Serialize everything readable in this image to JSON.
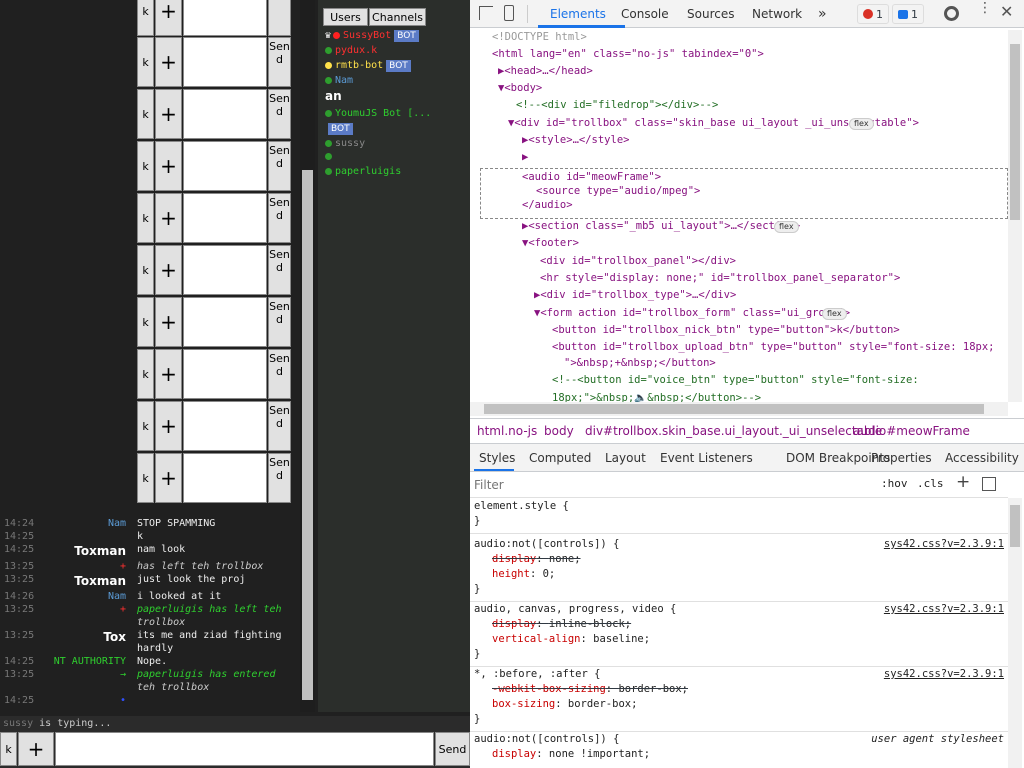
{
  "chat_form_rows": [
    {
      "k": "k",
      "plus": "+",
      "send": "end"
    },
    {
      "k": "k",
      "plus": "+",
      "send": "Send"
    },
    {
      "k": "k",
      "plus": "+",
      "send": "Send"
    },
    {
      "k": "k",
      "plus": "+",
      "send": "Send"
    },
    {
      "k": "k",
      "plus": "+",
      "send": "Send"
    },
    {
      "k": "k",
      "plus": "+",
      "send": "Send"
    },
    {
      "k": "k",
      "plus": "+",
      "send": "Send"
    },
    {
      "k": "k",
      "plus": "+",
      "send": "Send"
    },
    {
      "k": "k",
      "plus": "+",
      "send": "Send"
    },
    {
      "k": "k",
      "plus": "+",
      "send": "Send"
    }
  ],
  "users_panel": {
    "tabs": [
      "Users",
      "Channels"
    ],
    "users": [
      {
        "icon": "♛",
        "dot": "#ff2020",
        "name": "SussyBot",
        "color": "#ff3030",
        "bot": "BOT"
      },
      {
        "dot": "#2e9e2e",
        "name": "pydux.k",
        "color": "#ff3030",
        "bot": ""
      },
      {
        "dot": "#ffe14a",
        "name": "rmtb-bot",
        "color": "#ffe14a",
        "bot": "BOT"
      },
      {
        "dot": "#2e9e2e",
        "name": "Nam",
        "color": "#5b9bd5",
        "bot": ""
      },
      {
        "dot": "",
        "name": "an",
        "color": "#ffffff",
        "bot": ""
      },
      {
        "dot": "#2e9e2e",
        "name": "YoumuJS Bot [...",
        "color": "#2fcf2f",
        "bot": ""
      },
      {
        "dot": "",
        "name": "",
        "color": "#fff",
        "bot": "BOT"
      },
      {
        "dot": "#2e9e2e",
        "name": "sussy",
        "color": "#888888",
        "bot": ""
      },
      {
        "dot": "#2e9e2e",
        "name": "",
        "color": "#3050ff",
        "bot": ""
      },
      {
        "dot": "#2e9e2e",
        "name": "paperluigis",
        "color": "#2fcf2f",
        "bot": ""
      }
    ]
  },
  "messages": [
    {
      "time": "14:24",
      "nick": "Nam",
      "nick_color": "#5b9bd5",
      "text": "STOP SPAMMING",
      "italic": false
    },
    {
      "time": "14:25",
      "nick": "",
      "nick_color": "#888",
      "text": "k",
      "italic": false
    },
    {
      "time": "14:25",
      "nick": "Toxman",
      "nick_color": "#ffffff",
      "text": "nam look",
      "italic": false
    },
    {
      "time": "13:25",
      "nick": "+",
      "nick_color": "#ff3030",
      "text": "has left teh trollbox",
      "italic": true
    },
    {
      "time": "13:25",
      "nick": "Toxman",
      "nick_color": "#ffffff",
      "text": "just look the proj",
      "italic": false
    },
    {
      "time": "14:26",
      "nick": "Nam",
      "nick_color": "#5b9bd5",
      "text": "i looked at it",
      "italic": false
    },
    {
      "time": "13:25",
      "nick": "+",
      "nick_color": "#ff3030",
      "text": "paperluigis has left teh",
      "italic": true
    },
    {
      "time": "",
      "nick": "",
      "nick_color": "#888",
      "text": "trollbox",
      "italic": true
    },
    {
      "time": "13:25",
      "nick": "Tox",
      "nick_color": "#ffffff",
      "text": "its me and ziad fighting",
      "italic": false
    },
    {
      "time": "",
      "nick": "",
      "nick_color": "#888",
      "text": "hardly",
      "italic": false
    },
    {
      "time": "14:25",
      "nick": "NT AUTHORITY",
      "nick_color": "#2fcf2f",
      "text": "Nope.",
      "italic": false
    },
    {
      "time": "13:25",
      "nick": "→",
      "nick_color": "#2fcf2f",
      "text": "paperluigis has entered",
      "italic": true
    },
    {
      "time": "",
      "nick": "",
      "nick_color": "#888",
      "text": "teh trollbox",
      "italic": true
    },
    {
      "time": "14:25",
      "nick": "•",
      "nick_color": "#3050ff",
      "text": "",
      "italic": false
    }
  ],
  "typing": {
    "user": "sussy",
    "text": "is typing..."
  },
  "bottom_form": {
    "k": "k",
    "plus": "+",
    "send": "Send"
  },
  "devtools": {
    "tabs": [
      "Elements",
      "Console",
      "Sources",
      "Network",
      "»"
    ],
    "error_count": "1",
    "message_count": "1",
    "dom": [
      "<!DOCTYPE html>",
      "<html lang=\"en\" class=\"no-js\" tabindex=\"0\">",
      "▶<head>…</head>",
      "▼<body>",
      "<!--<div id=\"filedrop\"></div>-->",
      "▼<div id=\"trollbox\" class=\"skin_base ui_layout _ui_unselectable\">",
      "▶<style>…</style>",
      "▶",
      "<audio id=\"meowFrame\">",
      "<source type=\"audio/mpeg\">",
      "</audio>",
      "▶<section class=\"_mb5 ui_layout\">…</section>",
      "▼<footer>",
      "<div id=\"trollbox_panel\"></div>",
      "<hr style=\"display: none;\" id=\"trollbox_panel_separator\">",
      "▶<div id=\"trollbox_type\">…</div>",
      "▼<form action id=\"trollbox_form\" class=\"ui_group\">",
      "<button id=\"trollbox_nick_btn\" type=\"button\">k</button>",
      "<button id=\"trollbox_upload_btn\" type=\"button\" style=\"font-size: 18px;",
      "\">&nbsp;+&nbsp;</button>",
      "<!--<button id=\"voice_btn\" type=\"button\" style=\"font-size:",
      "18px;\">&nbsp;🔈&nbsp;</button>-->"
    ],
    "flex_badge": "flex",
    "breadcrumbs": [
      "html.no-js",
      "body",
      "div#trollbox.skin_base.ui_layout._ui_unselectable",
      "audio#meowFrame"
    ],
    "styles_tabs": [
      "Styles",
      "Computed",
      "Layout",
      "Event Listeners",
      "DOM Breakpoints",
      "Properties",
      "Accessibility"
    ],
    "filter_placeholder": "Filter",
    "hov": ":hov",
    "cls": ".cls",
    "rules": [
      {
        "selector": "element.style {",
        "source": "",
        "decls": []
      },
      {
        "selector": "audio:not([controls]) {",
        "source": "sys42.css?v=2.3.9:1",
        "decls": [
          {
            "prop": "display",
            "val": "none;",
            "strike": true
          },
          {
            "prop": "height",
            "val": "0;",
            "strike": false
          }
        ]
      },
      {
        "selector": "audio, canvas, progress, video {",
        "source": "sys42.css?v=2.3.9:1",
        "decls": [
          {
            "prop": "display",
            "val": "inline-block;",
            "strike": true
          },
          {
            "prop": "vertical-align",
            "val": "baseline;",
            "strike": false
          }
        ]
      },
      {
        "selector": "*, :before, :after {",
        "source": "sys42.css?v=2.3.9:1",
        "decls": [
          {
            "prop": "-webkit-box-sizing",
            "val": "border-box;",
            "strike": true
          },
          {
            "prop": "box-sizing",
            "val": "border-box;",
            "strike": false
          }
        ]
      },
      {
        "selector": "audio:not([controls]) {",
        "source": "user agent stylesheet",
        "decls": [
          {
            "prop": "display",
            "val": "none !important;",
            "strike": false
          }
        ]
      }
    ]
  }
}
